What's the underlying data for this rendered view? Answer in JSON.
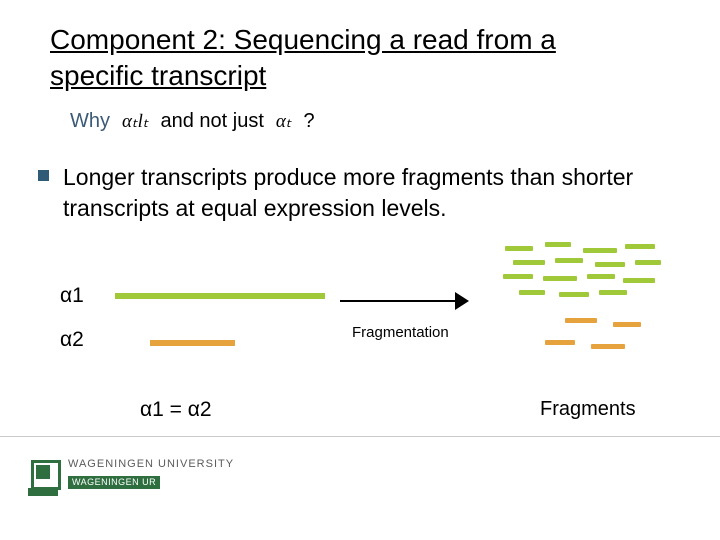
{
  "title": {
    "line1": "Component 2: Sequencing a read from a",
    "line2": "specific transcript"
  },
  "question": {
    "why": "Why",
    "expr1": "αₜlₜ",
    "mid": "and not just",
    "expr2": "αₜ",
    "qmark": "?"
  },
  "bullet": "Longer  transcripts produce more fragments than shorter transcripts at equal expression levels.",
  "alpha1": "α1",
  "alpha2": "α2",
  "fragmentation": "Fragmentation",
  "equation": "α1 = α2",
  "fragments": "Fragments",
  "logo": {
    "top": "WAGENINGEN UNIVERSITY",
    "bottom": "WAGENINGEN UR"
  }
}
